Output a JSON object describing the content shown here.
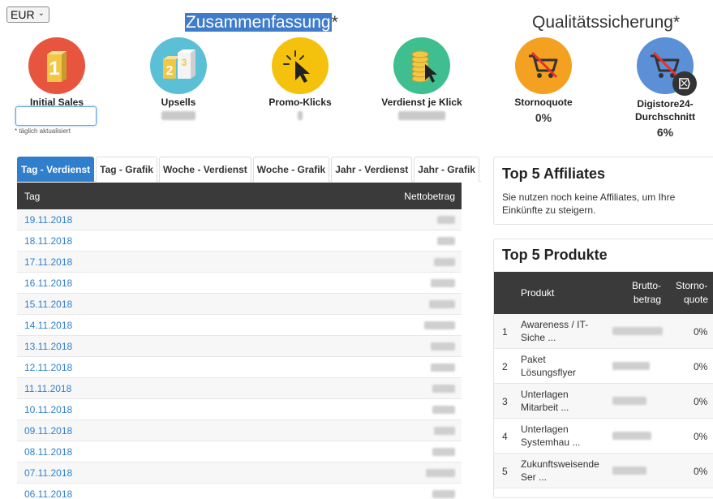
{
  "currency": {
    "selected": "EUR"
  },
  "sections": {
    "summary_title": "Zusammenfassung",
    "summary_star": "*",
    "quality_title": "Qualitätssicherung*"
  },
  "kpis": {
    "initial_sales": {
      "label": "Initial Sales",
      "color": "#e8553f"
    },
    "upsells": {
      "label": "Upsells",
      "color": "#5bbfd6"
    },
    "promo_klicks": {
      "label": "Promo-Klicks",
      "color": "#f4c20d"
    },
    "verdienst_klick": {
      "label": "Verdienst je Klick",
      "color": "#3fbf8f"
    },
    "stornoquote": {
      "label": "Stornoquote",
      "value": "0%",
      "color": "#f4a020"
    },
    "digistore": {
      "label": "Digistore24-Durchschnitt",
      "value": "6%",
      "color": "#5b8fd6"
    }
  },
  "footnote": "* täglich aktualisiert",
  "tabs": [
    {
      "label": "Tag - Verdienst",
      "active": true
    },
    {
      "label": "Tag - Grafik",
      "active": false
    },
    {
      "label": "Woche - Verdienst",
      "active": false
    },
    {
      "label": "Woche - Grafik",
      "active": false
    },
    {
      "label": "Jahr - Verdienst",
      "active": false
    },
    {
      "label": "Jahr - Grafik",
      "active": false
    }
  ],
  "day_table": {
    "col_day": "Tag",
    "col_amount": "Nettobetrag",
    "rows": [
      "19.11.2018",
      "18.11.2018",
      "17.11.2018",
      "16.11.2018",
      "15.11.2018",
      "14.11.2018",
      "13.11.2018",
      "12.11.2018",
      "11.11.2018",
      "10.11.2018",
      "09.11.2018",
      "08.11.2018",
      "07.11.2018",
      "06.11.2018"
    ]
  },
  "affiliates": {
    "title": "Top 5 Affiliates",
    "message": "Sie nutzen noch keine Affiliates, um Ihre Einkünfte zu steigern."
  },
  "products": {
    "title": "Top 5 Produkte",
    "col_product": "Produkt",
    "col_brutto_1": "Brutto-",
    "col_brutto_2": "betrag",
    "col_storno_1": "Storno-",
    "col_storno_2": "quote",
    "rows": [
      {
        "num": "1",
        "name_1": "Awareness / IT-",
        "name_2": "Siche ...",
        "quote": "0%"
      },
      {
        "num": "2",
        "name_1": "Paket",
        "name_2": "Lösungsflyer",
        "quote": "0%"
      },
      {
        "num": "3",
        "name_1": "Unterlagen",
        "name_2": "Mitarbeit ...",
        "quote": "0%"
      },
      {
        "num": "4",
        "name_1": "Unterlagen",
        "name_2": "Systemhau ...",
        "quote": "0%"
      },
      {
        "num": "5",
        "name_1": "Zukunftsweisende",
        "name_2": "Ser ...",
        "quote": "0%"
      }
    ]
  }
}
